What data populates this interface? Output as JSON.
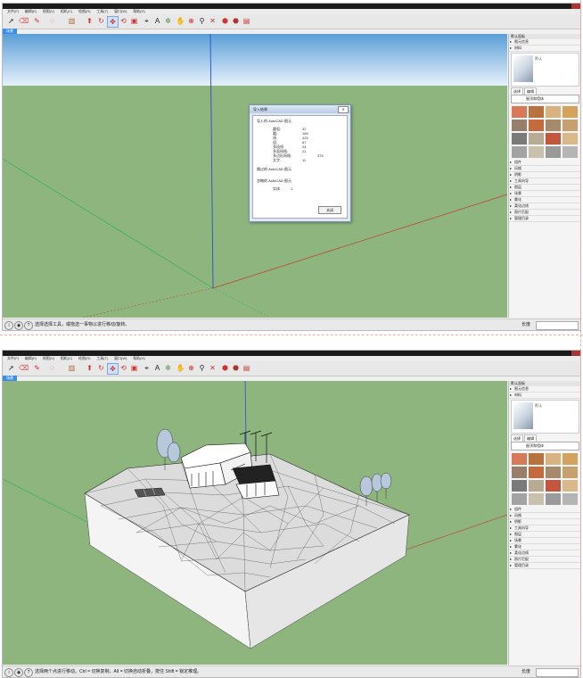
{
  "window": {
    "title_text": "",
    "menu": [
      "文件(F)",
      "编辑(E)",
      "视图(V)",
      "相机(C)",
      "绘图(R)",
      "工具(T)",
      "窗口(W)",
      "帮助(H)"
    ]
  },
  "scene_tab": "场景",
  "status": {
    "top_message": "选择选择工具，或拖选一事物以进行移动/旋转。",
    "bottom_message": "选择两个点进行移动。Ctrl = 切换复制，Alt = 切换自动折叠，按住 Shift = 锁定推理。",
    "length_label": "长度"
  },
  "tray": {
    "header": "默认面板",
    "entity_info": "图元信息",
    "materials": "材料",
    "material_name": "默认",
    "tabs": [
      "选择",
      "编辑"
    ],
    "library": "屋顶和墙体",
    "panels": [
      "组件",
      "风格",
      "阴影",
      "工具向导",
      "图层",
      "场景",
      "雾化",
      "柔化边线",
      "照片匹配",
      "管理目录"
    ]
  },
  "dialog": {
    "title": "导入结果",
    "section1": "导入的 AutoCAD 图元",
    "rows": [
      {
        "k": "圆弧:",
        "v": "32"
      },
      {
        "k": "圆:",
        "v": "189"
      },
      {
        "k": "线:",
        "v": "425"
      },
      {
        "k": "组:",
        "v": "67"
      },
      {
        "k": "多段线:",
        "v": "24"
      },
      {
        "k": "多面网格:",
        "v": "21"
      },
      {
        "k": "多边形网格:",
        "v": "376"
      },
      {
        "k": "文字:",
        "v": "11"
      }
    ],
    "section2": "跳过的 AutoCAD 图元",
    "section3": "忽略的 AutoCAD 图元",
    "ignored_rows": [
      {
        "k": "实体:",
        "v": "1"
      }
    ],
    "button": "关闭"
  },
  "colors": {
    "sky_top": "#5a9fd8",
    "sky_bottom": "#e7f1fa",
    "ground": "#8fb57e",
    "axis_red": "#c0392b",
    "axis_green": "#27ae60",
    "axis_blue": "#2e4bd1"
  },
  "icons": [
    "select-icon",
    "eraser-icon",
    "pencil-icon",
    "shape-icon",
    "paint-icon",
    "pushpull-icon",
    "move-icon",
    "rotate-icon",
    "scale-icon",
    "tape-icon",
    "text-icon",
    "orbit-icon",
    "pan-icon",
    "zoom-icon",
    "extents-icon",
    "warehouse-icon"
  ],
  "swatch_colors": [
    "#d87a5a",
    "#b7723e",
    "#d9b282",
    "#d3a25d",
    "#9a7e6c",
    "#c46a3c",
    "#a58a6c",
    "#c6a06e",
    "#7a7a7a",
    "#b9aa94",
    "#c4553e",
    "#d9b88a",
    "#a3a3a3",
    "#c9c0ad",
    "#9a9a9a",
    "#b5b5b5"
  ]
}
